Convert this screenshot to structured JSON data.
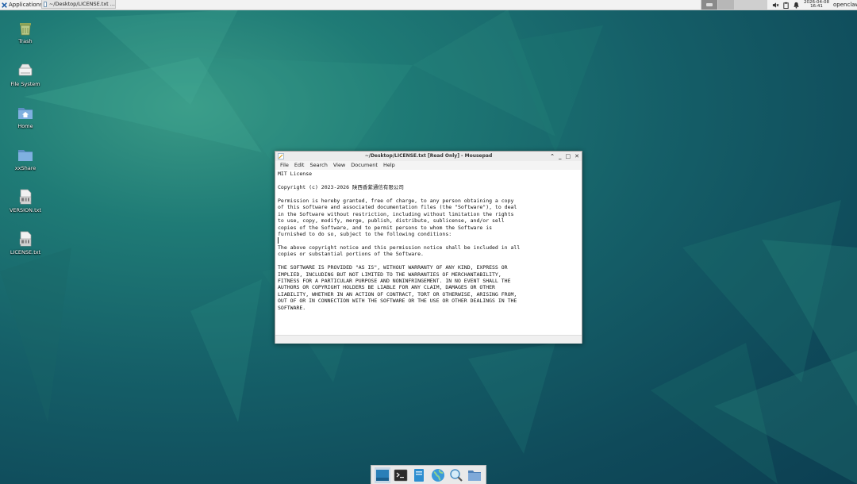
{
  "top_panel": {
    "applications_label": "Applications",
    "task_title": "~/Desktop/LICENSE.txt ...",
    "clock_date": "2026-04-08",
    "clock_time": "16:41",
    "user": "openclaw"
  },
  "desktop_icons": [
    {
      "label": "Trash",
      "icon": "trash-icon"
    },
    {
      "label": "File System",
      "icon": "drive-icon"
    },
    {
      "label": "Home",
      "icon": "home-folder-icon"
    },
    {
      "label": "xxShare",
      "icon": "folder-icon"
    },
    {
      "label": "VERSION.txt",
      "icon": "text-file-icon"
    },
    {
      "label": "LICENSE.txt",
      "icon": "text-file-icon"
    }
  ],
  "window": {
    "title": "~/Desktop/LICENSE.txt [Read Only] - Mousepad",
    "menu": [
      "File",
      "Edit",
      "Search",
      "View",
      "Document",
      "Help"
    ],
    "content_lines": [
      "MIT License",
      "",
      "Copyright (c) 2023-2026 陕西香紫通信有限公司",
      "",
      "Permission is hereby granted, free of charge, to any person obtaining a copy",
      "of this software and associated documentation files (the \"Software\"), to deal",
      "in the Software without restriction, including without limitation the rights",
      "to use, copy, modify, merge, publish, distribute, sublicense, and/or sell",
      "copies of the Software, and to permit persons to whom the Software is",
      "furnished to do so, subject to the following conditions:",
      "",
      "The above copyright notice and this permission notice shall be included in all",
      "copies or substantial portions of the Software.",
      "",
      "THE SOFTWARE IS PROVIDED \"AS IS\", WITHOUT WARRANTY OF ANY KIND, EXPRESS OR",
      "IMPLIED, INCLUDING BUT NOT LIMITED TO THE WARRANTIES OF MERCHANTABILITY,",
      "FITNESS FOR A PARTICULAR PURPOSE AND NONINFRINGEMENT. IN NO EVENT SHALL THE",
      "AUTHORS OR COPYRIGHT HOLDERS BE LIABLE FOR ANY CLAIM, DAMAGES OR OTHER",
      "LIABILITY, WHETHER IN AN ACTION OF CONTRACT, TORT OR OTHERWISE, ARISING FROM,",
      "OUT OF OR IN CONNECTION WITH THE SOFTWARE OR THE USE OR OTHER DEALINGS IN THE",
      "SOFTWARE."
    ]
  },
  "dock_items": [
    "show-desktop-icon",
    "terminal-icon",
    "file-manager-icon",
    "web-browser-icon",
    "search-icon",
    "folder-icon"
  ],
  "colors": {
    "desktop_bg": "#155f68",
    "panel_bg": "#f2f2f2",
    "window_bg": "#ffffff"
  }
}
